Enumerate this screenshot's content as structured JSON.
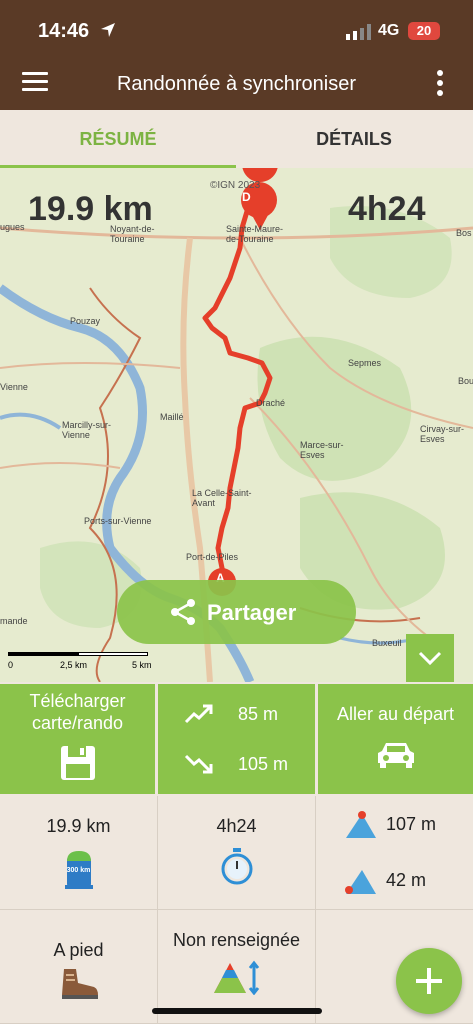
{
  "status": {
    "time": "14:46",
    "network": "4G",
    "battery": "20"
  },
  "appbar": {
    "title": "Randonnée à synchroniser"
  },
  "tabs": [
    {
      "label": "RÉSUMÉ"
    },
    {
      "label": "DÉTAILS"
    }
  ],
  "map": {
    "distance": "19.9 km",
    "duration": "4h24",
    "copyright": "©IGN 2023",
    "start_marker": "A",
    "end_marker": "D",
    "places": [
      "Noyant-de-Touraine",
      "Sainte-Maure-de-Touraine",
      "Pouzay",
      "Sepmes",
      "Maillé",
      "Draché",
      "Marcilly-sur-Vienne",
      "Cirvay-sur-Esves",
      "Marce-sur-Esves",
      "La Celle-Saint-Avant",
      "Ports-sur-Vienne",
      "Port-de-Piles",
      "Buxeuil",
      "Vienne",
      "Bos",
      "Bou",
      "ugues",
      "mande"
    ],
    "scale": [
      "0",
      "2,5 km",
      "5 km"
    ],
    "share_label": "Partager"
  },
  "actions": {
    "download": {
      "line1": "Télécharger",
      "line2": "carte/rando"
    },
    "elevation": {
      "gain": "85 m",
      "loss": "105 m"
    },
    "go_start": {
      "label": "Aller au départ"
    }
  },
  "stats": {
    "distance": "19.9 km",
    "duration": "4h24",
    "alt_max": "107 m",
    "alt_min": "42 m",
    "mode": "A pied",
    "difficulty": "Non renseignée",
    "distance_marker": "300 km"
  },
  "colors": {
    "brand_brown": "#5a3a26",
    "accent_green": "#8bc34a",
    "route_red": "#e53f2a"
  }
}
